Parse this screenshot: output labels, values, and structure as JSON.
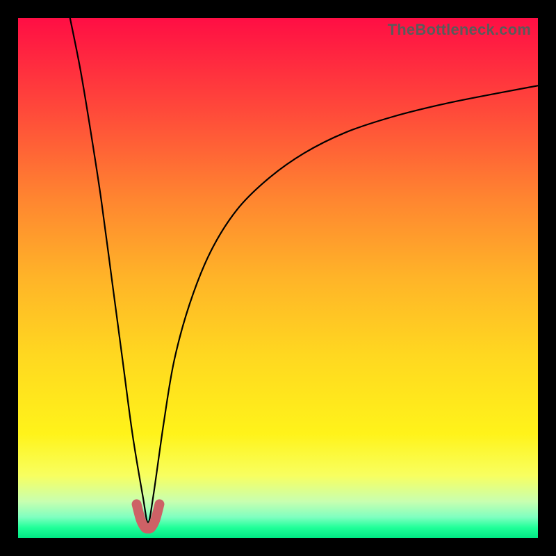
{
  "watermark": "TheBottleneck.com",
  "chart_data": {
    "type": "line",
    "title": "",
    "xlabel": "",
    "ylabel": "",
    "xlim": [
      0,
      100
    ],
    "ylim": [
      0,
      100
    ],
    "series": [
      {
        "name": "bottleneck-curve",
        "x": [
          10,
          12,
          14,
          16,
          18,
          20,
          22,
          24,
          25,
          26,
          28,
          30,
          33,
          37,
          42,
          48,
          55,
          63,
          72,
          82,
          92,
          100
        ],
        "values": [
          100,
          90,
          78,
          65,
          50,
          35,
          20,
          8,
          3,
          8,
          22,
          34,
          45,
          55,
          63,
          69,
          74,
          78,
          81,
          83.5,
          85.5,
          87
        ]
      },
      {
        "name": "highlight-dip",
        "x": [
          22.8,
          23.6,
          24.4,
          25.0,
          25.6,
          26.4,
          27.2
        ],
        "values": [
          6.5,
          3.5,
          2.0,
          1.8,
          2.0,
          3.5,
          6.5
        ]
      }
    ],
    "colors": {
      "curve": "#000000",
      "highlight": "#cd6166"
    }
  }
}
